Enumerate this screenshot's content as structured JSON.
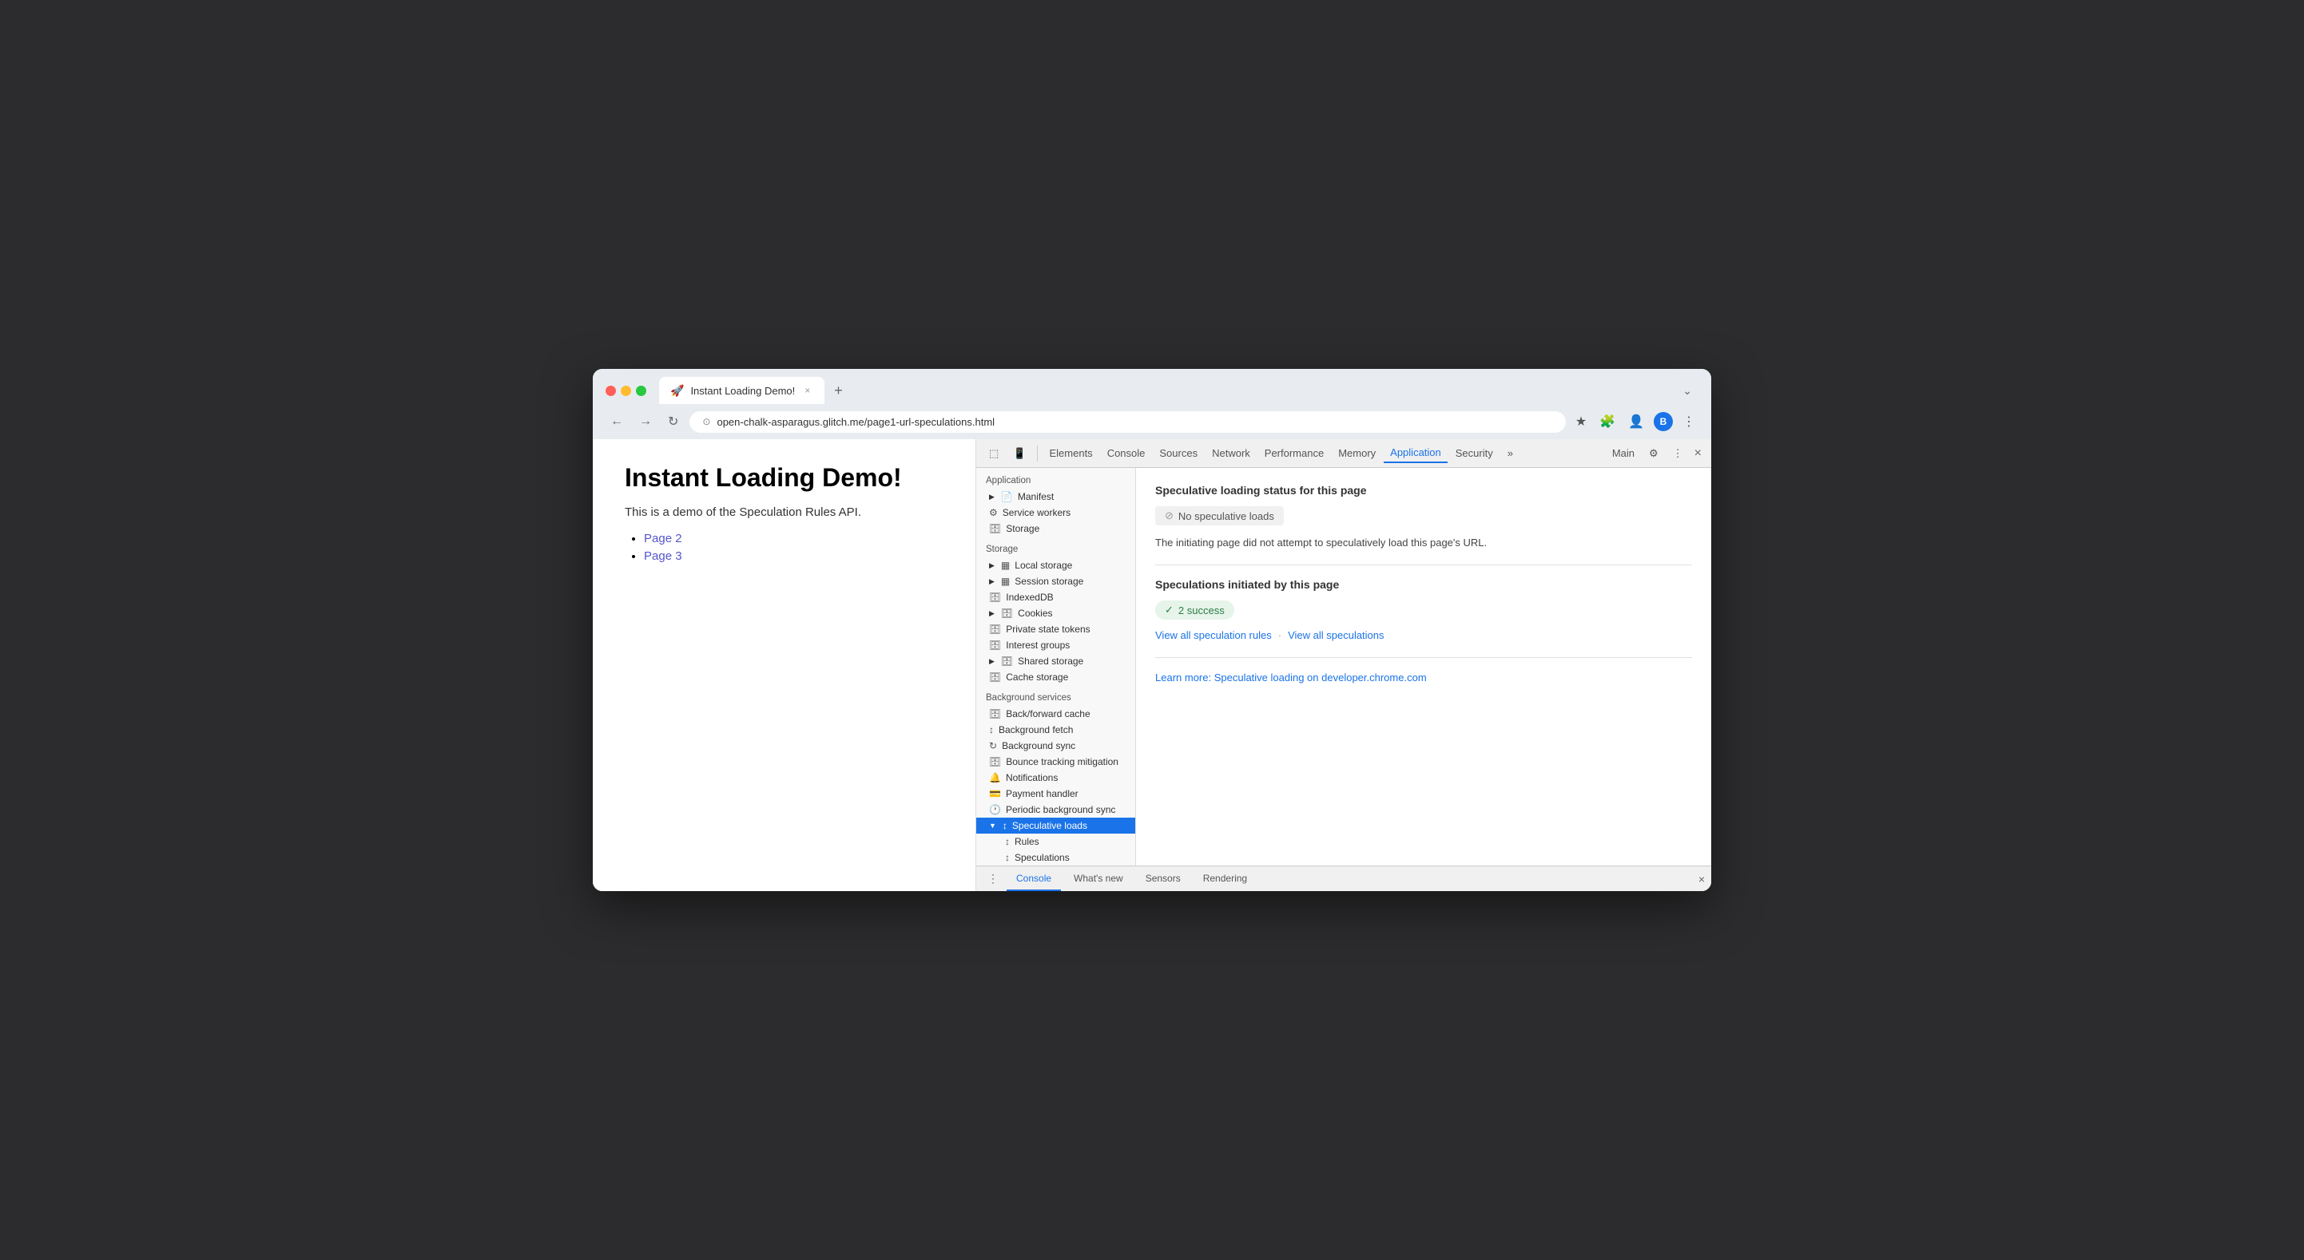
{
  "browser": {
    "traffic_lights": [
      "red",
      "yellow",
      "green"
    ],
    "tab": {
      "favicon": "🚀",
      "title": "Instant Loading Demo!",
      "close_label": "×"
    },
    "new_tab_label": "+",
    "nav": {
      "back": "←",
      "forward": "→",
      "reload": "↻",
      "security_icon": "⊙",
      "url": "open-chalk-asparagus.glitch.me/page1-url-speculations.html"
    },
    "toolbar_icons": [
      "★",
      "🧩",
      "👤",
      "B",
      "⋮"
    ],
    "expand_label": "⌄"
  },
  "webpage": {
    "heading": "Instant Loading Demo!",
    "description": "This is a demo of the Speculation Rules API.",
    "links": [
      {
        "text": "Page 2",
        "href": "#"
      },
      {
        "text": "Page 3",
        "href": "#"
      }
    ]
  },
  "devtools": {
    "tabs": [
      {
        "label": "Elements",
        "active": false
      },
      {
        "label": "Console",
        "active": false
      },
      {
        "label": "Sources",
        "active": false
      },
      {
        "label": "Network",
        "active": false
      },
      {
        "label": "Performance",
        "active": false
      },
      {
        "label": "Memory",
        "active": false
      },
      {
        "label": "Application",
        "active": true
      },
      {
        "label": "Security",
        "active": false
      },
      {
        "label": "»",
        "active": false
      }
    ],
    "context_label": "Main",
    "settings_icon": "⚙",
    "more_icon": "⋮",
    "close_icon": "×",
    "sidebar": {
      "sections": [
        {
          "label": "Application",
          "items": [
            {
              "id": "manifest",
              "icon": "📄",
              "label": "Manifest",
              "expandable": true,
              "level": 0
            },
            {
              "id": "service-workers",
              "icon": "⚙",
              "label": "Service workers",
              "expandable": false,
              "level": 0
            },
            {
              "id": "storage",
              "icon": "🗄",
              "label": "Storage",
              "expandable": false,
              "level": 0
            }
          ]
        },
        {
          "label": "Storage",
          "items": [
            {
              "id": "local-storage",
              "icon": "▦",
              "label": "Local storage",
              "expandable": true,
              "level": 0
            },
            {
              "id": "session-storage",
              "icon": "▦",
              "label": "Session storage",
              "expandable": true,
              "level": 0
            },
            {
              "id": "indexeddb",
              "icon": "🗄",
              "label": "IndexedDB",
              "expandable": false,
              "level": 0
            },
            {
              "id": "cookies",
              "icon": "🍪",
              "label": "Cookies",
              "expandable": true,
              "level": 0
            },
            {
              "id": "private-state",
              "icon": "🗄",
              "label": "Private state tokens",
              "expandable": false,
              "level": 0
            },
            {
              "id": "interest-groups",
              "icon": "🗄",
              "label": "Interest groups",
              "expandable": false,
              "level": 0
            },
            {
              "id": "shared-storage",
              "icon": "🗄",
              "label": "Shared storage",
              "expandable": true,
              "level": 0
            },
            {
              "id": "cache-storage",
              "icon": "🗄",
              "label": "Cache storage",
              "expandable": false,
              "level": 0
            }
          ]
        },
        {
          "label": "Background services",
          "items": [
            {
              "id": "back-forward-cache",
              "icon": "🗄",
              "label": "Back/forward cache",
              "expandable": false,
              "level": 0
            },
            {
              "id": "background-fetch",
              "icon": "↕",
              "label": "Background fetch",
              "expandable": false,
              "level": 0
            },
            {
              "id": "background-sync",
              "icon": "↻",
              "label": "Background sync",
              "expandable": false,
              "level": 0
            },
            {
              "id": "bounce-tracking",
              "icon": "🗄",
              "label": "Bounce tracking mitigation",
              "expandable": false,
              "level": 0
            },
            {
              "id": "notifications",
              "icon": "🔔",
              "label": "Notifications",
              "expandable": false,
              "level": 0
            },
            {
              "id": "payment-handler",
              "icon": "💳",
              "label": "Payment handler",
              "expandable": false,
              "level": 0
            },
            {
              "id": "periodic-sync",
              "icon": "🕐",
              "label": "Periodic background sync",
              "expandable": false,
              "level": 0
            },
            {
              "id": "speculative-loads",
              "icon": "↕",
              "label": "Speculative loads",
              "expandable": true,
              "expanded": true,
              "active": true,
              "level": 0
            },
            {
              "id": "rules",
              "icon": "↕",
              "label": "Rules",
              "expandable": false,
              "level": 1
            },
            {
              "id": "speculations",
              "icon": "↕",
              "label": "Speculations",
              "expandable": false,
              "level": 1
            }
          ]
        }
      ]
    },
    "content": {
      "status_section_title": "Speculative loading status for this page",
      "status_badge_icon": "⊘",
      "status_badge_text": "No speculative loads",
      "status_description": "The initiating page did not attempt to speculatively load this page's URL.",
      "initiated_section_title": "Speculations initiated by this page",
      "success_badge_icon": "✓",
      "success_count": "2 success",
      "view_rules_label": "View all speculation rules",
      "separator": "·",
      "view_speculations_label": "View all speculations",
      "learn_more_label": "Learn more: Speculative loading on developer.chrome.com"
    },
    "bottom_tabs": [
      {
        "label": "Console",
        "active": true
      },
      {
        "label": "What's new",
        "active": false
      },
      {
        "label": "Sensors",
        "active": false
      },
      {
        "label": "Rendering",
        "active": false
      }
    ],
    "bottom_more_icon": "⋮",
    "bottom_close_icon": "×"
  }
}
